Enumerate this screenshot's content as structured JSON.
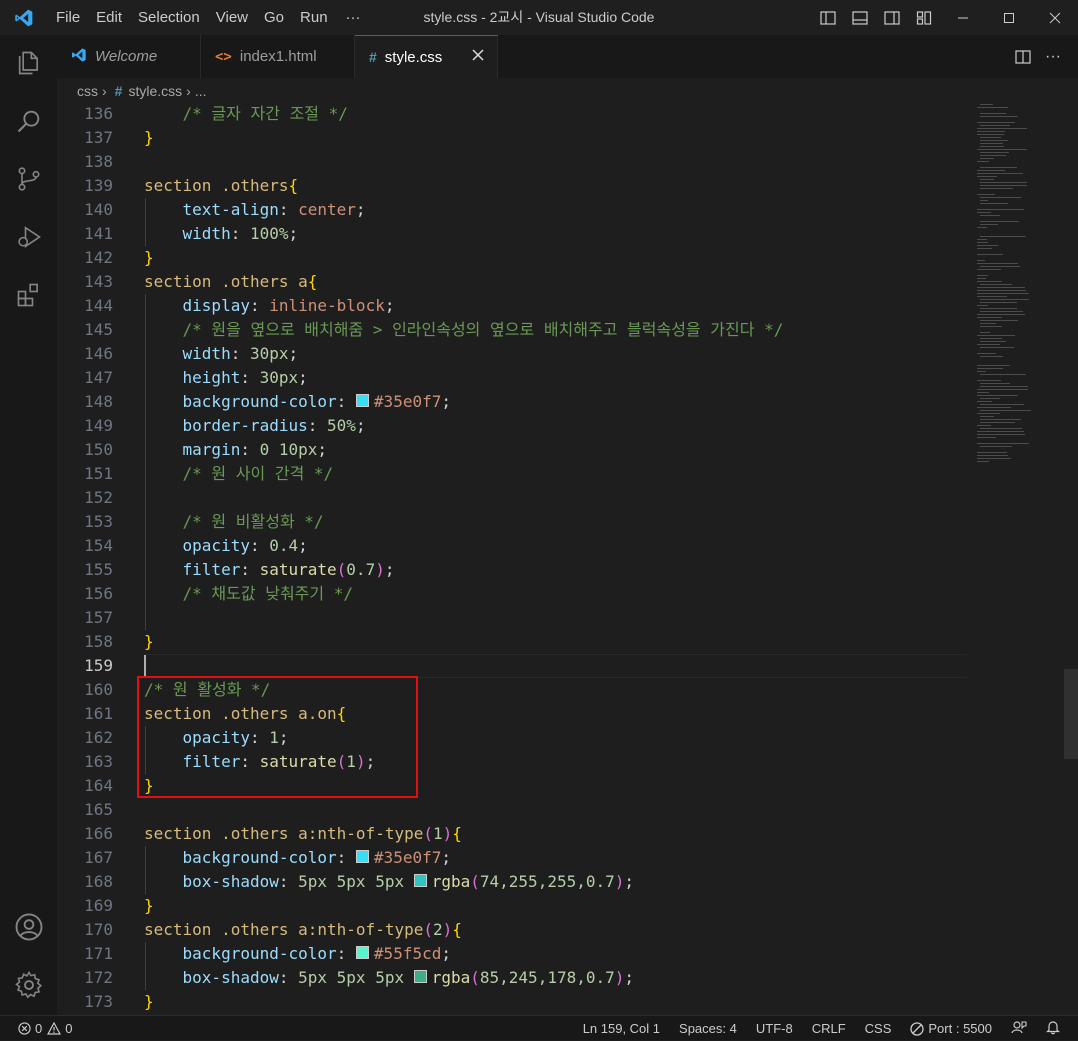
{
  "window": {
    "title": "style.css - 2교시 - Visual Studio Code"
  },
  "menu": [
    "File",
    "Edit",
    "Selection",
    "View",
    "Go",
    "Run",
    "···"
  ],
  "tabs": [
    {
      "label": "Welcome",
      "icon": "vscode-icon"
    },
    {
      "label": "index1.html",
      "icon": "html-icon"
    },
    {
      "label": "style.css",
      "icon": "css-icon",
      "active": true
    }
  ],
  "breadcrumb": {
    "folder": "css",
    "file": "style.css",
    "rest": "..."
  },
  "editor": {
    "current_line": 159,
    "lines": [
      {
        "n": "136",
        "t": [
          [
            "    ",
            ""
          ],
          [
            "/* 글자 자간 조절 */",
            "com"
          ]
        ]
      },
      {
        "n": "137",
        "t": [
          [
            "}",
            "br"
          ]
        ]
      },
      {
        "n": "138",
        "t": []
      },
      {
        "n": "139",
        "t": [
          [
            "section .others",
            "sel"
          ],
          [
            "{",
            "br"
          ]
        ]
      },
      {
        "n": "140",
        "t": [
          [
            "    ",
            ""
          ],
          [
            "text-align",
            "prop"
          ],
          [
            ": ",
            "punc"
          ],
          [
            "center",
            "val"
          ],
          [
            ";",
            "punc"
          ]
        ]
      },
      {
        "n": "141",
        "t": [
          [
            "    ",
            ""
          ],
          [
            "width",
            "prop"
          ],
          [
            ": ",
            "punc"
          ],
          [
            "100%",
            "num"
          ],
          [
            ";",
            "punc"
          ]
        ]
      },
      {
        "n": "142",
        "t": [
          [
            "}",
            "br"
          ]
        ]
      },
      {
        "n": "143",
        "t": [
          [
            "section .others a",
            "sel"
          ],
          [
            "{",
            "br"
          ]
        ]
      },
      {
        "n": "144",
        "t": [
          [
            "    ",
            ""
          ],
          [
            "display",
            "prop"
          ],
          [
            ": ",
            "punc"
          ],
          [
            "inline-block",
            "val"
          ],
          [
            ";",
            "punc"
          ]
        ]
      },
      {
        "n": "145",
        "t": [
          [
            "    ",
            ""
          ],
          [
            "/* 원을 옆으로 배치해줌 > 인라인속성의 옆으로 배치해주고 블럭속성을 가진다 */",
            "com"
          ]
        ]
      },
      {
        "n": "146",
        "t": [
          [
            "    ",
            ""
          ],
          [
            "width",
            "prop"
          ],
          [
            ": ",
            "punc"
          ],
          [
            "30px",
            "num"
          ],
          [
            ";",
            "punc"
          ]
        ]
      },
      {
        "n": "147",
        "t": [
          [
            "    ",
            ""
          ],
          [
            "height",
            "prop"
          ],
          [
            ": ",
            "punc"
          ],
          [
            "30px",
            "num"
          ],
          [
            ";",
            "punc"
          ]
        ]
      },
      {
        "n": "148",
        "t": [
          [
            "    ",
            ""
          ],
          [
            "background-color",
            "prop"
          ],
          [
            ": ",
            "punc"
          ],
          [
            "#35e0f7",
            "swatch"
          ],
          [
            "#35e0f7",
            "val"
          ],
          [
            ";",
            "punc"
          ]
        ]
      },
      {
        "n": "149",
        "t": [
          [
            "    ",
            ""
          ],
          [
            "border-radius",
            "prop"
          ],
          [
            ": ",
            "punc"
          ],
          [
            "50%",
            "num"
          ],
          [
            ";",
            "punc"
          ]
        ]
      },
      {
        "n": "150",
        "t": [
          [
            "    ",
            ""
          ],
          [
            "margin",
            "prop"
          ],
          [
            ": ",
            "punc"
          ],
          [
            "0 10px",
            "num"
          ],
          [
            ";",
            "punc"
          ]
        ]
      },
      {
        "n": "151",
        "t": [
          [
            "    ",
            ""
          ],
          [
            "/* 원 사이 간격 */",
            "com"
          ]
        ]
      },
      {
        "n": "152",
        "t": []
      },
      {
        "n": "153",
        "t": [
          [
            "    ",
            ""
          ],
          [
            "/* 원 비활성화 */",
            "com"
          ]
        ]
      },
      {
        "n": "154",
        "t": [
          [
            "    ",
            ""
          ],
          [
            "opacity",
            "prop"
          ],
          [
            ": ",
            "punc"
          ],
          [
            "0.4",
            "num"
          ],
          [
            ";",
            "punc"
          ]
        ]
      },
      {
        "n": "155",
        "t": [
          [
            "    ",
            ""
          ],
          [
            "filter",
            "prop"
          ],
          [
            ": ",
            "punc"
          ],
          [
            "saturate",
            "fn"
          ],
          [
            "(",
            "br2"
          ],
          [
            "0.7",
            "num"
          ],
          [
            ")",
            "br2"
          ],
          [
            ";",
            "punc"
          ]
        ]
      },
      {
        "n": "156",
        "t": [
          [
            "    ",
            ""
          ],
          [
            "/* 채도값 낮춰주기 */",
            "com"
          ]
        ]
      },
      {
        "n": "157",
        "t": []
      },
      {
        "n": "158",
        "t": [
          [
            "}",
            "br"
          ]
        ]
      },
      {
        "n": "159",
        "t": []
      },
      {
        "n": "160",
        "t": [
          [
            "/* 원 활성화 */",
            "com"
          ]
        ]
      },
      {
        "n": "161",
        "t": [
          [
            "section .others a.on",
            "sel"
          ],
          [
            "{",
            "br"
          ]
        ]
      },
      {
        "n": "162",
        "t": [
          [
            "    ",
            ""
          ],
          [
            "opacity",
            "prop"
          ],
          [
            ": ",
            "punc"
          ],
          [
            "1",
            "num"
          ],
          [
            ";",
            "punc"
          ]
        ]
      },
      {
        "n": "163",
        "t": [
          [
            "    ",
            ""
          ],
          [
            "filter",
            "prop"
          ],
          [
            ": ",
            "punc"
          ],
          [
            "saturate",
            "fn"
          ],
          [
            "(",
            "br2"
          ],
          [
            "1",
            "num"
          ],
          [
            ")",
            "br2"
          ],
          [
            ";",
            "punc"
          ]
        ]
      },
      {
        "n": "164",
        "t": [
          [
            "}",
            "br"
          ]
        ]
      },
      {
        "n": "165",
        "t": []
      },
      {
        "n": "166",
        "t": [
          [
            "section .others a:nth-of-type",
            "sel"
          ],
          [
            "(",
            "br2"
          ],
          [
            "1",
            "num"
          ],
          [
            ")",
            "br2"
          ],
          [
            "{",
            "br"
          ]
        ]
      },
      {
        "n": "167",
        "t": [
          [
            "    ",
            ""
          ],
          [
            "background-color",
            "prop"
          ],
          [
            ": ",
            "punc"
          ],
          [
            "#35e0f7",
            "swatch"
          ],
          [
            "#35e0f7",
            "val"
          ],
          [
            ";",
            "punc"
          ]
        ]
      },
      {
        "n": "168",
        "t": [
          [
            "    ",
            ""
          ],
          [
            "box-shadow",
            "prop"
          ],
          [
            ": ",
            "punc"
          ],
          [
            "5px 5px 5px ",
            "num"
          ],
          [
            "#2ec4c4",
            "swatch"
          ],
          [
            "rgba",
            "fn"
          ],
          [
            "(",
            "br2"
          ],
          [
            "74,255,255,0.7",
            "num"
          ],
          [
            ")",
            "br2"
          ],
          [
            ";",
            "punc"
          ]
        ]
      },
      {
        "n": "169",
        "t": [
          [
            "}",
            "br"
          ]
        ]
      },
      {
        "n": "170",
        "t": [
          [
            "section .others a:nth-of-type",
            "sel"
          ],
          [
            "(",
            "br2"
          ],
          [
            "2",
            "num"
          ],
          [
            ")",
            "br2"
          ],
          [
            "{",
            "br"
          ]
        ]
      },
      {
        "n": "171",
        "t": [
          [
            "    ",
            ""
          ],
          [
            "background-color",
            "prop"
          ],
          [
            ": ",
            "punc"
          ],
          [
            "#55f5cd",
            "swatch"
          ],
          [
            "#55f5cd",
            "val"
          ],
          [
            ";",
            "punc"
          ]
        ]
      },
      {
        "n": "172",
        "t": [
          [
            "    ",
            ""
          ],
          [
            "box-shadow",
            "prop"
          ],
          [
            ": ",
            "punc"
          ],
          [
            "5px 5px 5px ",
            "num"
          ],
          [
            "#3fae85",
            "swatch"
          ],
          [
            "rgba",
            "fn"
          ],
          [
            "(",
            "br2"
          ],
          [
            "85,245,178,0.7",
            "num"
          ],
          [
            ")",
            "br2"
          ],
          [
            ";",
            "punc"
          ]
        ]
      },
      {
        "n": "173",
        "t": [
          [
            "}",
            "br"
          ]
        ]
      }
    ]
  },
  "status": {
    "errors": "0",
    "warnings": "0",
    "position": "Ln 159, Col 1",
    "spaces": "Spaces: 4",
    "encoding": "UTF-8",
    "eol": "CRLF",
    "language": "CSS",
    "port": "Port : 5500"
  },
  "colors": {
    "accent": "#0078d4",
    "highlight_box": "#e01010"
  }
}
